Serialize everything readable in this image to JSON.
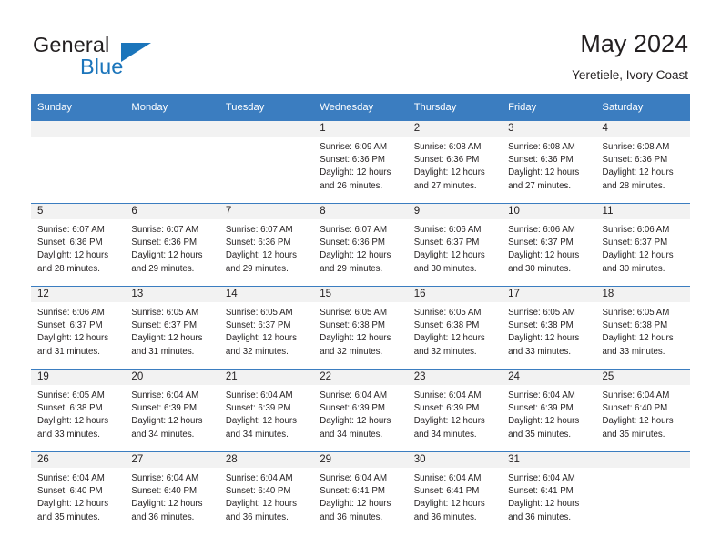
{
  "brand": {
    "word1": "General",
    "word2": "Blue",
    "triangle_color": "#1b75bb"
  },
  "header": {
    "title": "May 2024",
    "subtitle": "Yeretiele, Ivory Coast"
  },
  "theme": {
    "header_bg": "#3b7dc0",
    "header_text": "#ffffff",
    "daynum_band_bg": "#f2f2f2",
    "cell_text": "#231f20",
    "row_divider": "#3b7dc0"
  },
  "weekdays": [
    "Sunday",
    "Monday",
    "Tuesday",
    "Wednesday",
    "Thursday",
    "Friday",
    "Saturday"
  ],
  "labels": {
    "sunrise_prefix": "Sunrise:",
    "sunset_prefix": "Sunset:",
    "daylight_prefix": "Daylight:"
  },
  "weeks": [
    [
      {
        "day": "",
        "empty": true
      },
      {
        "day": "",
        "empty": true
      },
      {
        "day": "",
        "empty": true
      },
      {
        "day": "1",
        "sunrise": "Sunrise: 6:09 AM",
        "sunset": "Sunset: 6:36 PM",
        "daylight1": "Daylight: 12 hours",
        "daylight2": "and 26 minutes."
      },
      {
        "day": "2",
        "sunrise": "Sunrise: 6:08 AM",
        "sunset": "Sunset: 6:36 PM",
        "daylight1": "Daylight: 12 hours",
        "daylight2": "and 27 minutes."
      },
      {
        "day": "3",
        "sunrise": "Sunrise: 6:08 AM",
        "sunset": "Sunset: 6:36 PM",
        "daylight1": "Daylight: 12 hours",
        "daylight2": "and 27 minutes."
      },
      {
        "day": "4",
        "sunrise": "Sunrise: 6:08 AM",
        "sunset": "Sunset: 6:36 PM",
        "daylight1": "Daylight: 12 hours",
        "daylight2": "and 28 minutes."
      }
    ],
    [
      {
        "day": "5",
        "sunrise": "Sunrise: 6:07 AM",
        "sunset": "Sunset: 6:36 PM",
        "daylight1": "Daylight: 12 hours",
        "daylight2": "and 28 minutes."
      },
      {
        "day": "6",
        "sunrise": "Sunrise: 6:07 AM",
        "sunset": "Sunset: 6:36 PM",
        "daylight1": "Daylight: 12 hours",
        "daylight2": "and 29 minutes."
      },
      {
        "day": "7",
        "sunrise": "Sunrise: 6:07 AM",
        "sunset": "Sunset: 6:36 PM",
        "daylight1": "Daylight: 12 hours",
        "daylight2": "and 29 minutes."
      },
      {
        "day": "8",
        "sunrise": "Sunrise: 6:07 AM",
        "sunset": "Sunset: 6:36 PM",
        "daylight1": "Daylight: 12 hours",
        "daylight2": "and 29 minutes."
      },
      {
        "day": "9",
        "sunrise": "Sunrise: 6:06 AM",
        "sunset": "Sunset: 6:37 PM",
        "daylight1": "Daylight: 12 hours",
        "daylight2": "and 30 minutes."
      },
      {
        "day": "10",
        "sunrise": "Sunrise: 6:06 AM",
        "sunset": "Sunset: 6:37 PM",
        "daylight1": "Daylight: 12 hours",
        "daylight2": "and 30 minutes."
      },
      {
        "day": "11",
        "sunrise": "Sunrise: 6:06 AM",
        "sunset": "Sunset: 6:37 PM",
        "daylight1": "Daylight: 12 hours",
        "daylight2": "and 30 minutes."
      }
    ],
    [
      {
        "day": "12",
        "sunrise": "Sunrise: 6:06 AM",
        "sunset": "Sunset: 6:37 PM",
        "daylight1": "Daylight: 12 hours",
        "daylight2": "and 31 minutes."
      },
      {
        "day": "13",
        "sunrise": "Sunrise: 6:05 AM",
        "sunset": "Sunset: 6:37 PM",
        "daylight1": "Daylight: 12 hours",
        "daylight2": "and 31 minutes."
      },
      {
        "day": "14",
        "sunrise": "Sunrise: 6:05 AM",
        "sunset": "Sunset: 6:37 PM",
        "daylight1": "Daylight: 12 hours",
        "daylight2": "and 32 minutes."
      },
      {
        "day": "15",
        "sunrise": "Sunrise: 6:05 AM",
        "sunset": "Sunset: 6:38 PM",
        "daylight1": "Daylight: 12 hours",
        "daylight2": "and 32 minutes."
      },
      {
        "day": "16",
        "sunrise": "Sunrise: 6:05 AM",
        "sunset": "Sunset: 6:38 PM",
        "daylight1": "Daylight: 12 hours",
        "daylight2": "and 32 minutes."
      },
      {
        "day": "17",
        "sunrise": "Sunrise: 6:05 AM",
        "sunset": "Sunset: 6:38 PM",
        "daylight1": "Daylight: 12 hours",
        "daylight2": "and 33 minutes."
      },
      {
        "day": "18",
        "sunrise": "Sunrise: 6:05 AM",
        "sunset": "Sunset: 6:38 PM",
        "daylight1": "Daylight: 12 hours",
        "daylight2": "and 33 minutes."
      }
    ],
    [
      {
        "day": "19",
        "sunrise": "Sunrise: 6:05 AM",
        "sunset": "Sunset: 6:38 PM",
        "daylight1": "Daylight: 12 hours",
        "daylight2": "and 33 minutes."
      },
      {
        "day": "20",
        "sunrise": "Sunrise: 6:04 AM",
        "sunset": "Sunset: 6:39 PM",
        "daylight1": "Daylight: 12 hours",
        "daylight2": "and 34 minutes."
      },
      {
        "day": "21",
        "sunrise": "Sunrise: 6:04 AM",
        "sunset": "Sunset: 6:39 PM",
        "daylight1": "Daylight: 12 hours",
        "daylight2": "and 34 minutes."
      },
      {
        "day": "22",
        "sunrise": "Sunrise: 6:04 AM",
        "sunset": "Sunset: 6:39 PM",
        "daylight1": "Daylight: 12 hours",
        "daylight2": "and 34 minutes."
      },
      {
        "day": "23",
        "sunrise": "Sunrise: 6:04 AM",
        "sunset": "Sunset: 6:39 PM",
        "daylight1": "Daylight: 12 hours",
        "daylight2": "and 34 minutes."
      },
      {
        "day": "24",
        "sunrise": "Sunrise: 6:04 AM",
        "sunset": "Sunset: 6:39 PM",
        "daylight1": "Daylight: 12 hours",
        "daylight2": "and 35 minutes."
      },
      {
        "day": "25",
        "sunrise": "Sunrise: 6:04 AM",
        "sunset": "Sunset: 6:40 PM",
        "daylight1": "Daylight: 12 hours",
        "daylight2": "and 35 minutes."
      }
    ],
    [
      {
        "day": "26",
        "sunrise": "Sunrise: 6:04 AM",
        "sunset": "Sunset: 6:40 PM",
        "daylight1": "Daylight: 12 hours",
        "daylight2": "and 35 minutes."
      },
      {
        "day": "27",
        "sunrise": "Sunrise: 6:04 AM",
        "sunset": "Sunset: 6:40 PM",
        "daylight1": "Daylight: 12 hours",
        "daylight2": "and 36 minutes."
      },
      {
        "day": "28",
        "sunrise": "Sunrise: 6:04 AM",
        "sunset": "Sunset: 6:40 PM",
        "daylight1": "Daylight: 12 hours",
        "daylight2": "and 36 minutes."
      },
      {
        "day": "29",
        "sunrise": "Sunrise: 6:04 AM",
        "sunset": "Sunset: 6:41 PM",
        "daylight1": "Daylight: 12 hours",
        "daylight2": "and 36 minutes."
      },
      {
        "day": "30",
        "sunrise": "Sunrise: 6:04 AM",
        "sunset": "Sunset: 6:41 PM",
        "daylight1": "Daylight: 12 hours",
        "daylight2": "and 36 minutes."
      },
      {
        "day": "31",
        "sunrise": "Sunrise: 6:04 AM",
        "sunset": "Sunset: 6:41 PM",
        "daylight1": "Daylight: 12 hours",
        "daylight2": "and 36 minutes."
      },
      {
        "day": "",
        "empty": true
      }
    ]
  ]
}
